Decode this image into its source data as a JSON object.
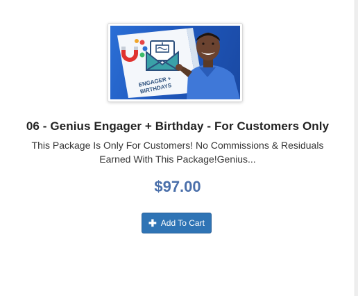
{
  "product": {
    "title": "06 - Genius Engager + Birthday - For Customers Only",
    "description_line1": "This Package Is Only For Customers! No Commissions & Residuals",
    "description_line2": "Earned With This Package!Genius...",
    "price": "$97.00",
    "image": {
      "caption_line1": "ENGAGER +",
      "caption_line2": "BIRTHDAYS",
      "icons": [
        "magnet-icon",
        "envelope-cake-icon",
        "person-pointing"
      ]
    }
  },
  "actions": {
    "add_to_cart_label": "Add To Cart",
    "add_to_cart_icon": "plus-icon"
  },
  "colors": {
    "price": "#4a6faa",
    "button": "#2f74b5",
    "image_bg": "#1f58bd"
  }
}
